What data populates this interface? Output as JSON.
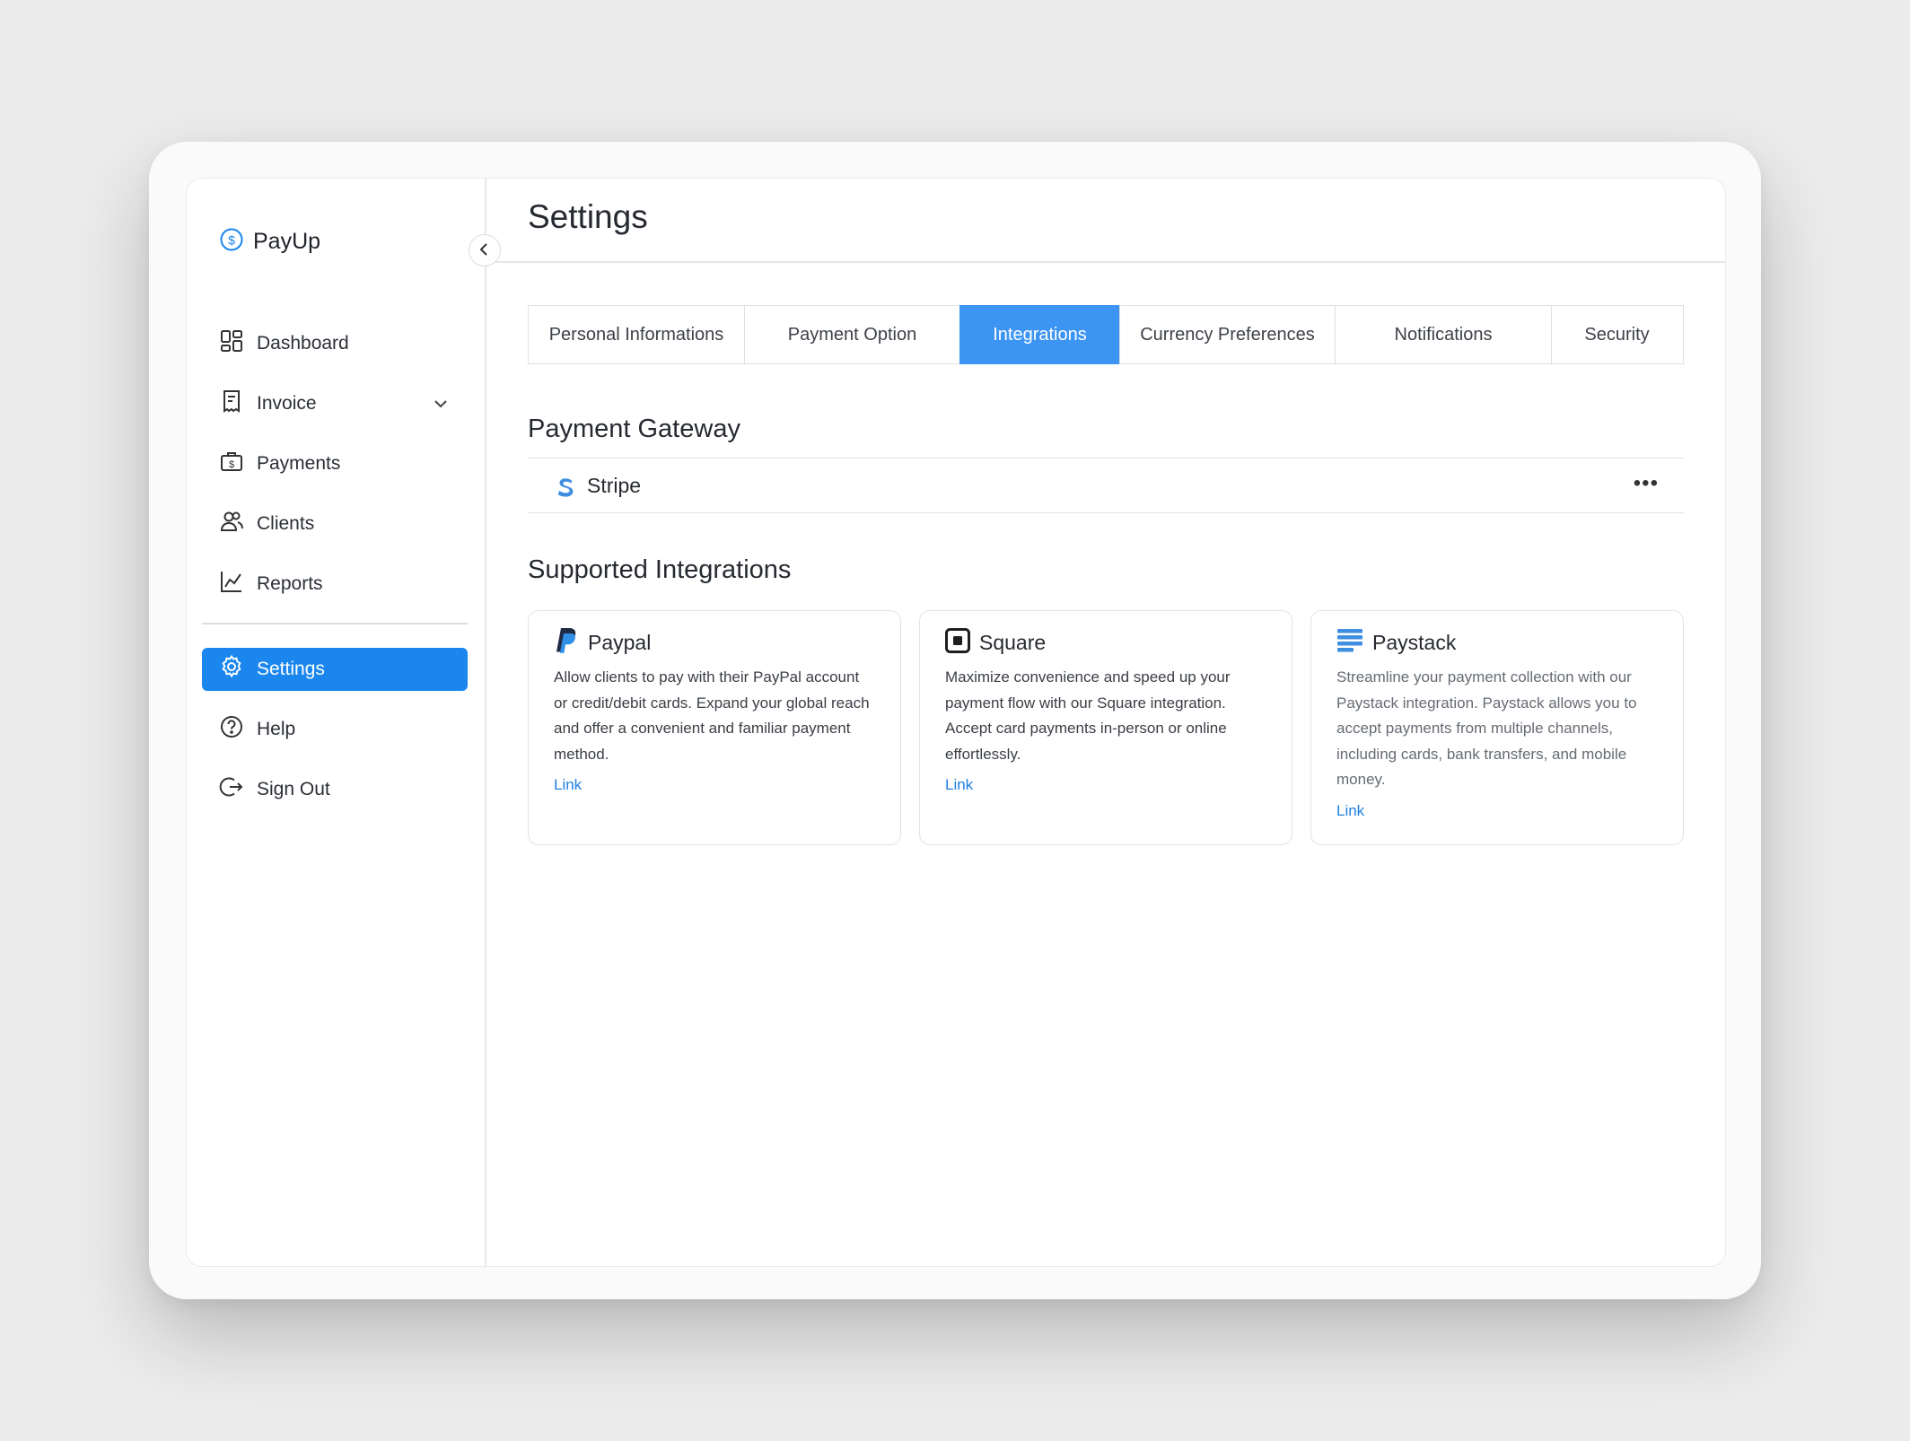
{
  "brand": {
    "name": "PayUp",
    "accent": "#1a86ee"
  },
  "sidebar": {
    "items": [
      {
        "label": "Dashboard",
        "icon": "dashboard-icon"
      },
      {
        "label": "Invoice",
        "icon": "invoice-icon"
      },
      {
        "label": "Payments",
        "icon": "payments-icon"
      },
      {
        "label": "Clients",
        "icon": "clients-icon"
      },
      {
        "label": "Reports",
        "icon": "reports-icon"
      }
    ],
    "bottom_items": [
      {
        "label": "Settings",
        "icon": "gear-icon",
        "active": true
      },
      {
        "label": "Help",
        "icon": "help-icon"
      },
      {
        "label": "Sign Out",
        "icon": "sign-out-icon"
      }
    ]
  },
  "page": {
    "title": "Settings"
  },
  "tabs": [
    {
      "label": "Personal Informations"
    },
    {
      "label": "Payment Option"
    },
    {
      "label": "Integrations",
      "active": true
    },
    {
      "label": "Currency Preferences"
    },
    {
      "label": "Notifications"
    },
    {
      "label": "Security"
    }
  ],
  "gateway": {
    "section_title": "Payment Gateway",
    "name": "Stripe",
    "more": "•••"
  },
  "integrations": {
    "section_title": "Supported Integrations",
    "cards": [
      {
        "title": "Paypal",
        "description": "Allow clients to pay with their PayPal account or credit/debit cards. Expand your global reach and offer a convenient and familiar payment method.",
        "link": "Link"
      },
      {
        "title": "Square",
        "description": "Maximize convenience and speed up your payment flow with our Square integration. Accept card payments in-person or online effortlessly.",
        "link": "Link"
      },
      {
        "title": "Paystack",
        "description": "Streamline your payment collection with our Paystack integration. Paystack allows you to accept payments from multiple channels, including cards, bank transfers, and mobile money.",
        "link": "Link"
      }
    ]
  }
}
